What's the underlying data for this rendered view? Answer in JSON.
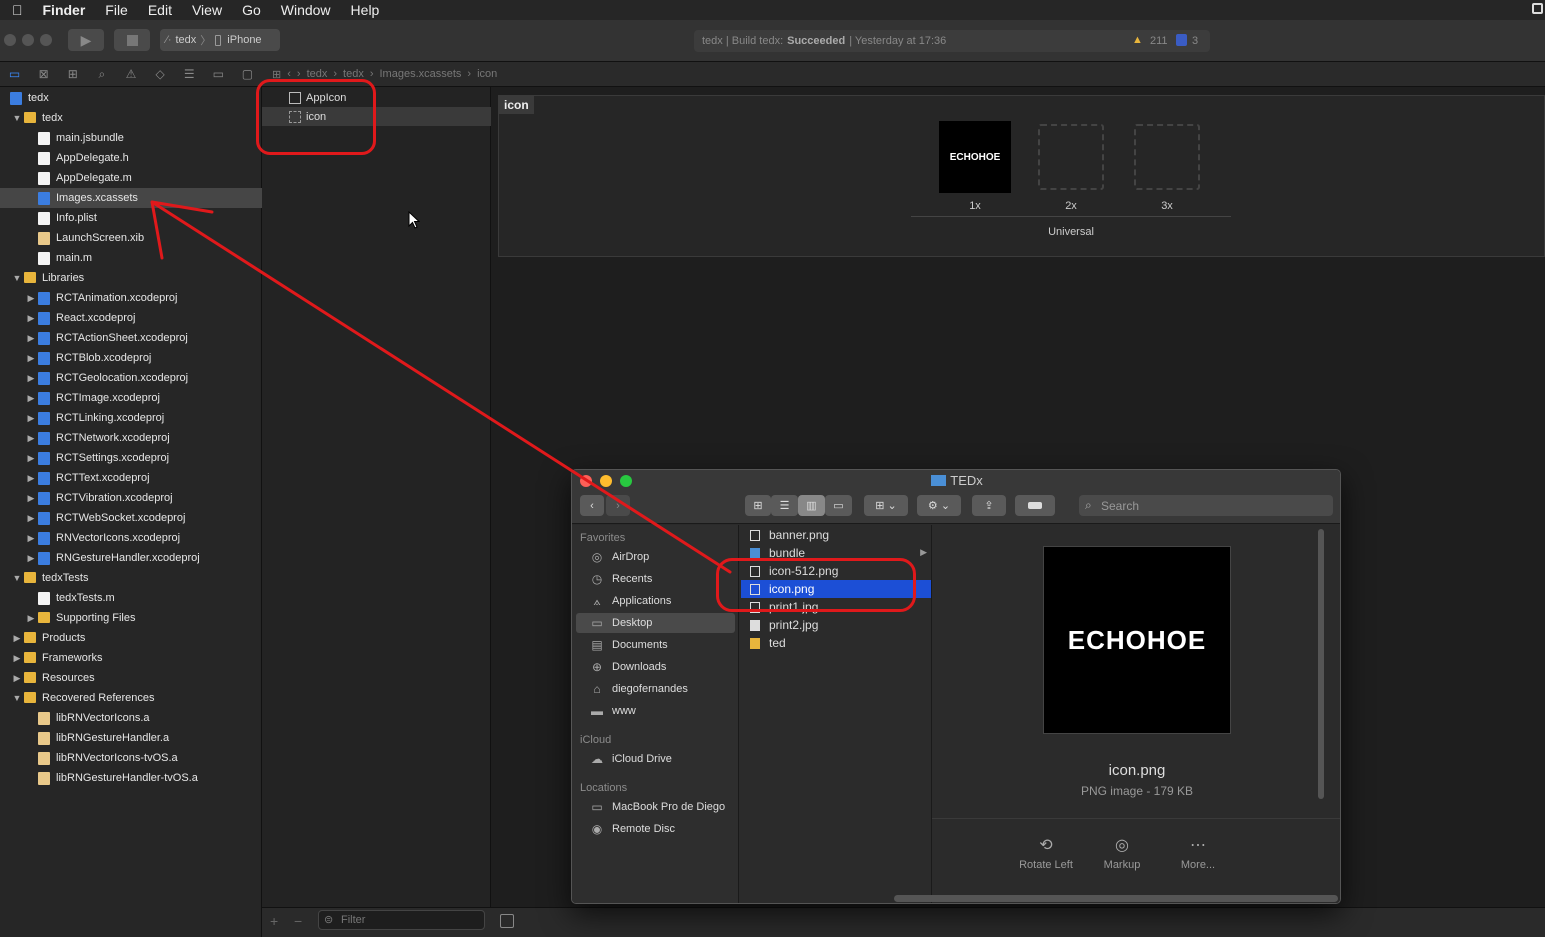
{
  "menubar": {
    "apple": "",
    "app": "Finder",
    "items": [
      "File",
      "Edit",
      "View",
      "Go",
      "Window",
      "Help"
    ]
  },
  "toolbar": {
    "scheme": "tedx",
    "device": "iPhone",
    "status_prefix": "tedx | Build tedx:",
    "status_result": "Succeeded",
    "status_time": "| Yesterday at 17:36",
    "warnings": "211",
    "issues": "3"
  },
  "jumpbar": {
    "crumbs": [
      "tedx",
      "tedx",
      "Images.xcassets",
      "icon"
    ]
  },
  "navigator": {
    "rows": [
      {
        "label": "tedx",
        "icon": "proj",
        "indent": 0,
        "tri": ""
      },
      {
        "label": "tedx",
        "icon": "fold",
        "indent": 1,
        "tri": "▼"
      },
      {
        "label": "main.jsbundle",
        "icon": "doc",
        "indent": 2,
        "tri": ""
      },
      {
        "label": "AppDelegate.h",
        "icon": "doc",
        "indent": 2,
        "tri": ""
      },
      {
        "label": "AppDelegate.m",
        "icon": "doc",
        "indent": 2,
        "tri": ""
      },
      {
        "label": "Images.xcassets",
        "icon": "proj",
        "indent": 2,
        "tri": "",
        "selected": true
      },
      {
        "label": "Info.plist",
        "icon": "doc",
        "indent": 2,
        "tri": ""
      },
      {
        "label": "LaunchScreen.xib",
        "icon": "lib",
        "indent": 2,
        "tri": ""
      },
      {
        "label": "main.m",
        "icon": "doc",
        "indent": 2,
        "tri": ""
      },
      {
        "label": "Libraries",
        "icon": "fold",
        "indent": 1,
        "tri": "▼"
      },
      {
        "label": "RCTAnimation.xcodeproj",
        "icon": "proj",
        "indent": 2,
        "tri": "▶"
      },
      {
        "label": "React.xcodeproj",
        "icon": "proj",
        "indent": 2,
        "tri": "▶"
      },
      {
        "label": "RCTActionSheet.xcodeproj",
        "icon": "proj",
        "indent": 2,
        "tri": "▶"
      },
      {
        "label": "RCTBlob.xcodeproj",
        "icon": "proj",
        "indent": 2,
        "tri": "▶"
      },
      {
        "label": "RCTGeolocation.xcodeproj",
        "icon": "proj",
        "indent": 2,
        "tri": "▶"
      },
      {
        "label": "RCTImage.xcodeproj",
        "icon": "proj",
        "indent": 2,
        "tri": "▶"
      },
      {
        "label": "RCTLinking.xcodeproj",
        "icon": "proj",
        "indent": 2,
        "tri": "▶"
      },
      {
        "label": "RCTNetwork.xcodeproj",
        "icon": "proj",
        "indent": 2,
        "tri": "▶"
      },
      {
        "label": "RCTSettings.xcodeproj",
        "icon": "proj",
        "indent": 2,
        "tri": "▶"
      },
      {
        "label": "RCTText.xcodeproj",
        "icon": "proj",
        "indent": 2,
        "tri": "▶"
      },
      {
        "label": "RCTVibration.xcodeproj",
        "icon": "proj",
        "indent": 2,
        "tri": "▶"
      },
      {
        "label": "RCTWebSocket.xcodeproj",
        "icon": "proj",
        "indent": 2,
        "tri": "▶"
      },
      {
        "label": "RNVectorIcons.xcodeproj",
        "icon": "proj",
        "indent": 2,
        "tri": "▶"
      },
      {
        "label": "RNGestureHandler.xcodeproj",
        "icon": "proj",
        "indent": 2,
        "tri": "▶"
      },
      {
        "label": "tedxTests",
        "icon": "fold",
        "indent": 1,
        "tri": "▼"
      },
      {
        "label": "tedxTests.m",
        "icon": "doc",
        "indent": 2,
        "tri": ""
      },
      {
        "label": "Supporting Files",
        "icon": "fold",
        "indent": 2,
        "tri": "▶"
      },
      {
        "label": "Products",
        "icon": "fold",
        "indent": 1,
        "tri": "▶"
      },
      {
        "label": "Frameworks",
        "icon": "fold",
        "indent": 1,
        "tri": "▶"
      },
      {
        "label": "Resources",
        "icon": "fold",
        "indent": 1,
        "tri": "▶"
      },
      {
        "label": "Recovered References",
        "icon": "fold",
        "indent": 1,
        "tri": "▼"
      },
      {
        "label": "libRNVectorIcons.a",
        "icon": "lib",
        "indent": 2,
        "tri": ""
      },
      {
        "label": "libRNGestureHandler.a",
        "icon": "lib",
        "indent": 2,
        "tri": ""
      },
      {
        "label": "libRNVectorIcons-tvOS.a",
        "icon": "lib",
        "indent": 2,
        "tri": ""
      },
      {
        "label": "libRNGestureHandler-tvOS.a",
        "icon": "lib",
        "indent": 2,
        "tri": ""
      }
    ]
  },
  "assets": {
    "items": [
      {
        "label": "AppIcon"
      },
      {
        "label": "icon",
        "selected": true
      }
    ],
    "filter_placeholder": "Filter"
  },
  "editor": {
    "set_name": "icon",
    "thumb_text": "ECHOHOE",
    "slots": [
      "1x",
      "2x",
      "3x"
    ],
    "group": "Universal"
  },
  "finder": {
    "title": "TEDx",
    "search_placeholder": "Search",
    "sidebar": {
      "favorites_head": "Favorites",
      "favorites": [
        {
          "label": "AirDrop",
          "icon": "airdrop-icon",
          "glyph": "◎"
        },
        {
          "label": "Recents",
          "icon": "clock-icon",
          "glyph": "◷"
        },
        {
          "label": "Applications",
          "icon": "applications-icon",
          "glyph": "⟑"
        },
        {
          "label": "Desktop",
          "icon": "desktop-icon",
          "glyph": "▭",
          "selected": true
        },
        {
          "label": "Documents",
          "icon": "document-icon",
          "glyph": "▤"
        },
        {
          "label": "Downloads",
          "icon": "download-icon",
          "glyph": "⊕"
        },
        {
          "label": "diegofernandes",
          "icon": "home-icon",
          "glyph": "⌂"
        },
        {
          "label": "www",
          "icon": "folder-icon",
          "glyph": "▬"
        }
      ],
      "icloud_head": "iCloud",
      "icloud": [
        {
          "label": "iCloud Drive",
          "icon": "cloud-icon",
          "glyph": "☁"
        }
      ],
      "locations_head": "Locations",
      "locations": [
        {
          "label": "MacBook Pro de Diego",
          "icon": "laptop-icon",
          "glyph": "▭"
        },
        {
          "label": "Remote Disc",
          "icon": "disc-icon",
          "glyph": "◉"
        }
      ]
    },
    "files": [
      {
        "label": "banner.png",
        "icon": "doc"
      },
      {
        "label": "bundle",
        "icon": "fold",
        "folder": true
      },
      {
        "label": "icon-512.png",
        "icon": "doc"
      },
      {
        "label": "icon.png",
        "icon": "doc",
        "selected": true
      },
      {
        "label": "print1.jpg",
        "icon": "doc"
      },
      {
        "label": "print2.jpg",
        "icon": "img"
      },
      {
        "label": "ted",
        "icon": "ted"
      }
    ],
    "preview": {
      "thumb_text": "ECHOHOE",
      "name": "icon.png",
      "meta": "PNG image - 179 KB",
      "actions": [
        "Rotate Left",
        "Markup",
        "More..."
      ]
    }
  },
  "colors": {
    "annotation": "#e0191b",
    "selection": "#1c4fd6",
    "accent": "#3c8cff"
  }
}
